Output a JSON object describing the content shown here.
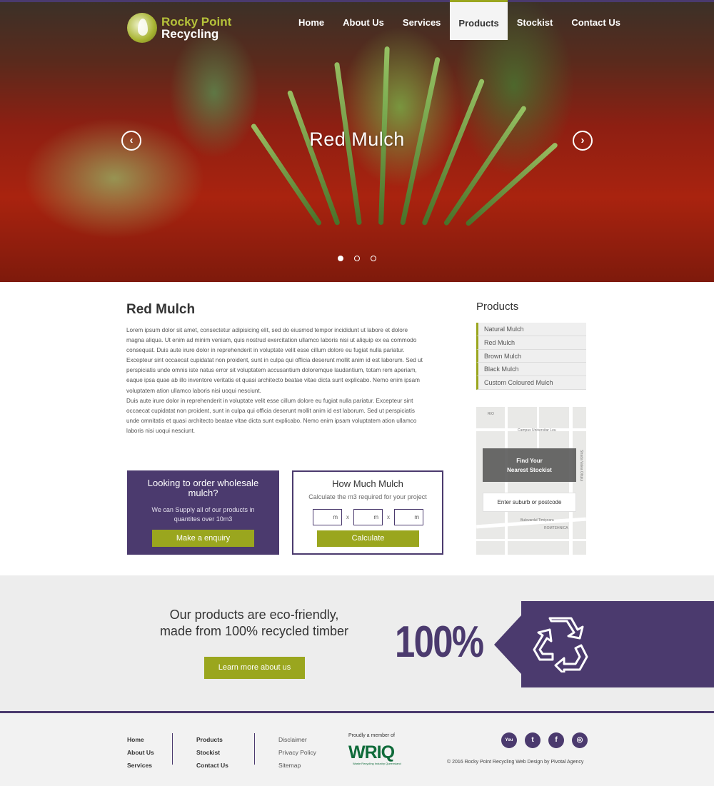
{
  "brand": {
    "name_line1": "Rocky Point",
    "name_line2": "Recycling"
  },
  "nav": {
    "items": [
      {
        "label": "Home"
      },
      {
        "label": "About Us"
      },
      {
        "label": "Services"
      },
      {
        "label": "Products",
        "active": true
      },
      {
        "label": "Stockist"
      },
      {
        "label": "Contact Us"
      }
    ]
  },
  "hero": {
    "title": "Red Mulch",
    "prev_icon": "chevron-left-icon",
    "next_icon": "chevron-right-icon",
    "slide_count": 3,
    "active_slide": 1
  },
  "main": {
    "title": "Red Mulch",
    "body": "Lorem ipsum dolor sit amet, consectetur adipisicing elit, sed do eiusmod tempor incididunt ut labore et dolore magna aliqua. Ut enim ad minim veniam, quis nostrud exercitation ullamco laboris nisi ut aliquip ex ea commodo consequat. Duis aute irure dolor in reprehenderit in voluptate velit esse cillum dolore eu fugiat nulla pariatur. Excepteur sint occaecat cupidatat non proident, sunt in culpa qui officia deserunt mollit anim id est laborum. Sed ut perspiciatis unde omnis iste natus error sit voluptatem accusantium doloremque laudantium, totam rem aperiam, eaque ipsa quae ab illo inventore veritatis et quasi architecto beatae vitae dicta sunt explicabo. Nemo enim ipsam voluptatem ation ullamco laboris nisi uoqui nesciunt.",
    "body2": "Duis aute irure dolor in reprehenderit in voluptate velit esse cillum dolore eu fugiat nulla pariatur. Excepteur sint occaecat cupidatat non proident, sunt in culpa qui officia deserunt mollit anim id est laborum. Sed ut perspiciatis unde omnitatis et quasi architecto beatae vitae dicta sunt explicabo. Nemo enim ipsam voluptatem ation ullamco laboris nisi uoqui nesciunt."
  },
  "sidebar": {
    "title": "Products",
    "items": [
      {
        "label": "Natural Mulch"
      },
      {
        "label": "Red Mulch"
      },
      {
        "label": "Brown Mulch"
      },
      {
        "label": "Black Mulch"
      },
      {
        "label": "Custom Coloured Mulch"
      }
    ],
    "map": {
      "overlay_line1": "Find Your",
      "overlay_line2": "Nearest Stockist",
      "input_placeholder": "Enter suburb or postcode",
      "street_labels": [
        "RIO",
        "Campus Universitar Leu",
        "Bulevardul Timișoara",
        "ROMTEHNICA",
        "Strada Valea Oltului"
      ]
    }
  },
  "wholesale": {
    "heading": "Looking to order wholesale mulch?",
    "text": "We can Supply all of our products in quantites over 10m3",
    "button": "Make a enquiry"
  },
  "calculator": {
    "heading": "How Much Mulch",
    "subtitle": "Calculate the m3 required for your project",
    "unit": "m",
    "separator": "x",
    "button": "Calculate"
  },
  "eco": {
    "line1": "Our products are eco-friendly,",
    "line2": "made from 100% recycled timber",
    "button": "Learn more about us",
    "big_number": "100%",
    "icon": "recycle-icon"
  },
  "footer": {
    "col1": [
      "Home",
      "About Us",
      "Services"
    ],
    "col2": [
      "Products",
      "Stockist",
      "Contact Us"
    ],
    "col3": [
      "Disclaimer",
      "Privacy Policy",
      "Sitemap"
    ],
    "member_label": "Proudly a member of",
    "member_logo": "WRIQ",
    "member_sub": "Waste Recycling Industry Queensland",
    "social": [
      {
        "icon": "youtube-icon",
        "glyph": "You"
      },
      {
        "icon": "twitter-icon",
        "glyph": "t"
      },
      {
        "icon": "facebook-icon",
        "glyph": "f"
      },
      {
        "icon": "instagram-icon",
        "glyph": "◎"
      }
    ],
    "copyright": "© 2016 Rocky Point Recycling Web Design by Pivotal Agency"
  },
  "colors": {
    "purple": "#4b3a6e",
    "olive": "#9aa61e",
    "grey_band": "#ededed"
  }
}
